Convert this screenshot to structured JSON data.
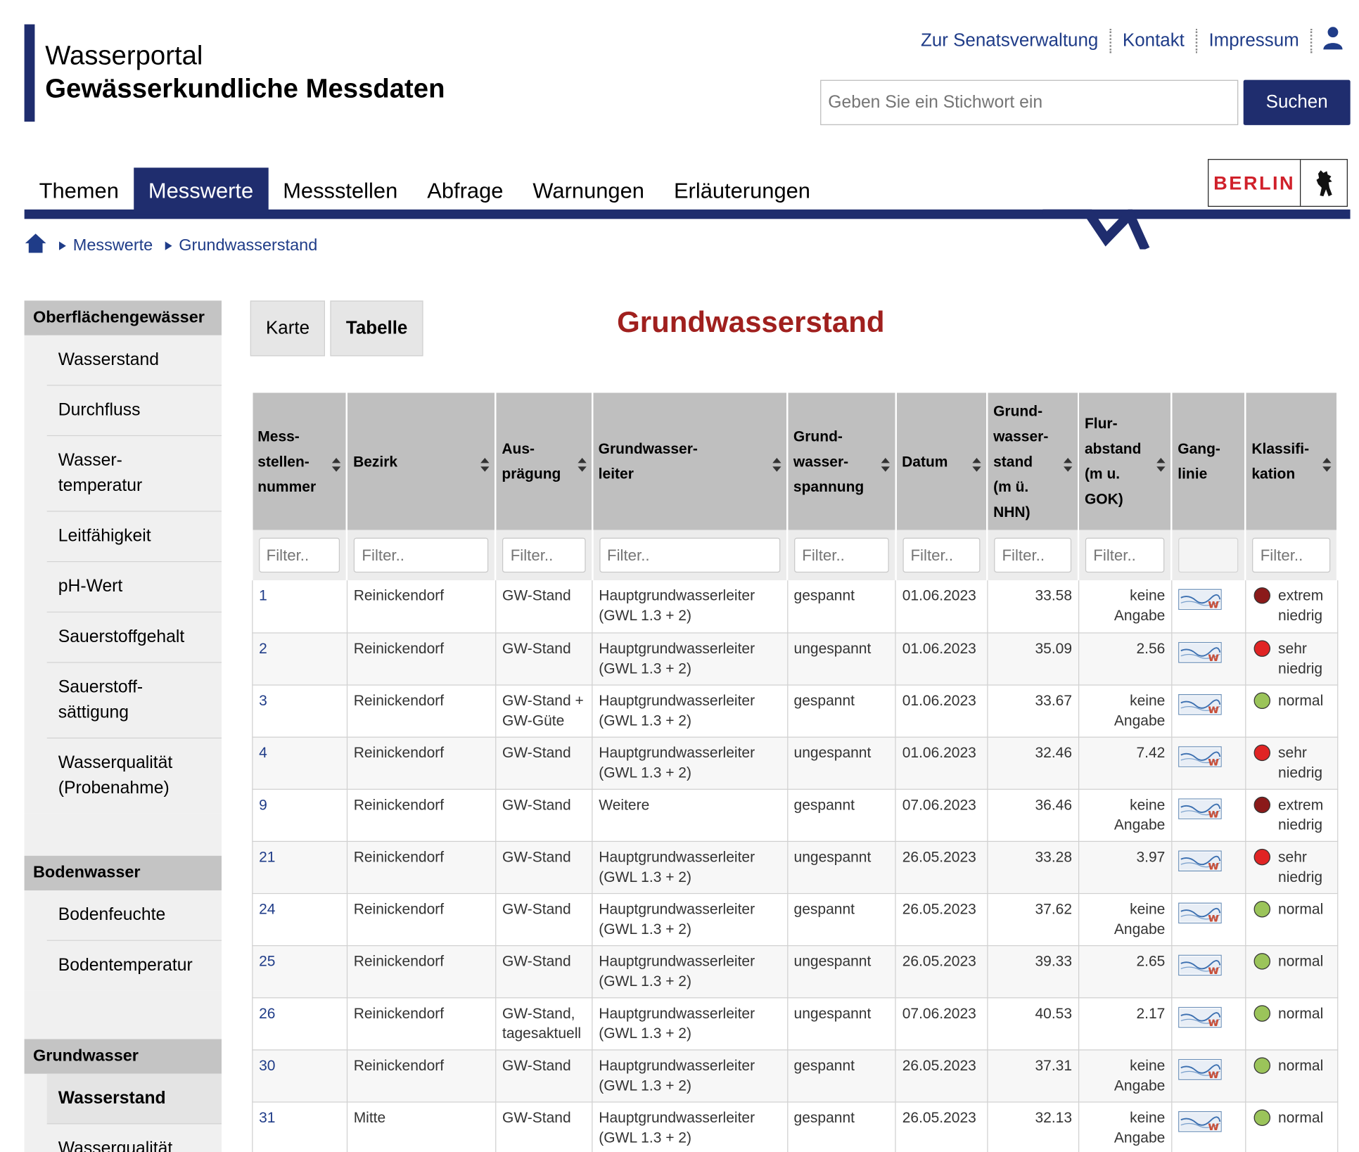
{
  "header": {
    "title_line1": "Wasserportal",
    "title_line2": "Gewässerkundliche Messdaten",
    "links": [
      "Zur Senatsverwaltung",
      "Kontakt",
      "Impressum"
    ],
    "user_icon": "user-icon",
    "search": {
      "placeholder": "Geben Sie ein Stichwort ein",
      "button": "Suchen"
    },
    "logo_text": "BERLIN"
  },
  "nav": {
    "items": [
      "Themen",
      "Messwerte",
      "Messstellen",
      "Abfrage",
      "Warnungen",
      "Erläuterungen"
    ],
    "active": "Messwerte"
  },
  "breadcrumb": {
    "home_icon": "home-icon",
    "items": [
      "Messwerte",
      "Grundwasserstand"
    ]
  },
  "sidebar": {
    "sections": [
      {
        "title": "Oberflächengewässer",
        "items": [
          "Wasserstand",
          "Durchfluss",
          "Wasser-\ntemperatur",
          "Leitfähigkeit",
          "pH-Wert",
          "Sauerstoffgehalt",
          "Sauerstoff-\nsättigung",
          "Wasserqualität\n(Probenahme)"
        ]
      },
      {
        "title": "Bodenwasser",
        "items": [
          "Bodenfeuchte",
          "Bodentemperatur"
        ]
      },
      {
        "title": "Grundwasser",
        "items": [
          "Wasserstand",
          "Wasserqualität"
        ],
        "active": "Wasserstand"
      }
    ]
  },
  "tabs": [
    "Karte",
    "Tabelle"
  ],
  "active_tab": "Tabelle",
  "page_title": "Grundwasserstand",
  "table": {
    "columns": [
      "Mess-\nstellen-\nnummer",
      "Bezirk",
      "Aus-\nprägung",
      "Grundwasser-\nleiter",
      "Grund-\nwasser-\nspannung",
      "Datum",
      "Grund-\nwasser-\nstand\n(m ü.\nNHN)",
      "Flur-\nabstand\n(m u.\nGOK)",
      "Gang-\nlinie",
      "Klassifi-\nkation"
    ],
    "filter_placeholder": "Filter..",
    "colors": {
      "extrem niedrig": "#8b1a1a",
      "sehr niedrig": "#e02424",
      "normal": "#9bc45a"
    },
    "rows": [
      [
        "1",
        "Reinickendorf",
        "GW-Stand",
        "Hauptgrundwasserleiter (GWL 1.3 + 2)",
        "gespannt",
        "01.06.2023",
        "33.58",
        "keine Angabe",
        "extrem niedrig"
      ],
      [
        "2",
        "Reinickendorf",
        "GW-Stand",
        "Hauptgrundwasserleiter (GWL 1.3 + 2)",
        "ungespannt",
        "01.06.2023",
        "35.09",
        "2.56",
        "sehr niedrig"
      ],
      [
        "3",
        "Reinickendorf",
        "GW-Stand + GW-Güte",
        "Hauptgrundwasserleiter (GWL 1.3 + 2)",
        "gespannt",
        "01.06.2023",
        "33.67",
        "keine Angabe",
        "normal"
      ],
      [
        "4",
        "Reinickendorf",
        "GW-Stand",
        "Hauptgrundwasserleiter (GWL 1.3 + 2)",
        "ungespannt",
        "01.06.2023",
        "32.46",
        "7.42",
        "sehr niedrig"
      ],
      [
        "9",
        "Reinickendorf",
        "GW-Stand",
        "Weitere",
        "gespannt",
        "07.06.2023",
        "36.46",
        "keine Angabe",
        "extrem niedrig"
      ],
      [
        "21",
        "Reinickendorf",
        "GW-Stand",
        "Hauptgrundwasserleiter (GWL 1.3 + 2)",
        "ungespannt",
        "26.05.2023",
        "33.28",
        "3.97",
        "sehr niedrig"
      ],
      [
        "24",
        "Reinickendorf",
        "GW-Stand",
        "Hauptgrundwasserleiter (GWL 1.3 + 2)",
        "gespannt",
        "26.05.2023",
        "37.62",
        "keine Angabe",
        "normal"
      ],
      [
        "25",
        "Reinickendorf",
        "GW-Stand",
        "Hauptgrundwasserleiter (GWL 1.3 + 2)",
        "ungespannt",
        "26.05.2023",
        "39.33",
        "2.65",
        "normal"
      ],
      [
        "26",
        "Reinickendorf",
        "GW-Stand, tagesaktuell",
        "Hauptgrundwasserleiter (GWL 1.3 + 2)",
        "ungespannt",
        "07.06.2023",
        "40.53",
        "2.17",
        "normal"
      ],
      [
        "30",
        "Reinickendorf",
        "GW-Stand",
        "Hauptgrundwasserleiter (GWL 1.3 + 2)",
        "gespannt",
        "26.05.2023",
        "37.31",
        "keine Angabe",
        "normal"
      ],
      [
        "31",
        "Mitte",
        "GW-Stand",
        "Hauptgrundwasserleiter (GWL 1.3 + 2)",
        "gespannt",
        "26.05.2023",
        "32.13",
        "keine Angabe",
        "normal"
      ]
    ]
  }
}
